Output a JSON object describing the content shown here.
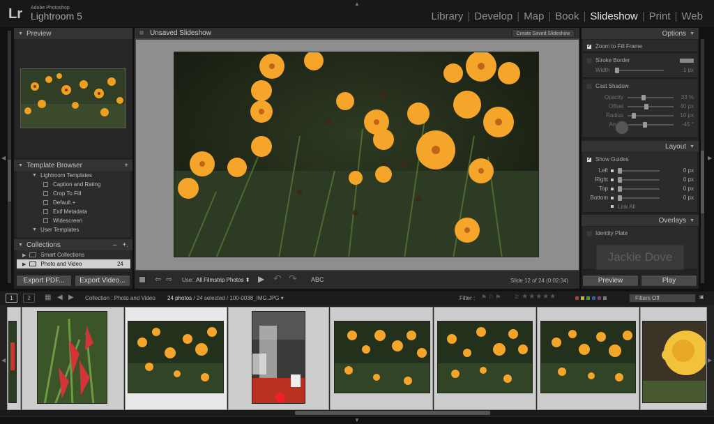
{
  "app": {
    "logo": "Lr",
    "brand_small": "Adobe Photoshop",
    "brand_name": "Lightroom 5"
  },
  "modules": [
    {
      "label": "Library",
      "active": false
    },
    {
      "label": "Develop",
      "active": false
    },
    {
      "label": "Map",
      "active": false
    },
    {
      "label": "Book",
      "active": false
    },
    {
      "label": "Slideshow",
      "active": true
    },
    {
      "label": "Print",
      "active": false
    },
    {
      "label": "Web",
      "active": false
    }
  ],
  "left_panel": {
    "preview_header": "Preview",
    "template_browser_header": "Template Browser",
    "template_browser_add": "+",
    "lightroom_templates": "Lightroom Templates",
    "templates": [
      "Caption and Rating",
      "Crop To Fill",
      "Default +",
      "Exif Metadata",
      "Widescreen"
    ],
    "user_templates": "User Templates",
    "collections_header": "Collections",
    "collections_minus": "–",
    "collections_plus": "+.",
    "smart_collections": "Smart Collections",
    "photo_and_video": "Photo and Video",
    "photo_and_video_count": "24",
    "export_pdf": "Export PDF...",
    "export_video": "Export Video..."
  },
  "center": {
    "title": "Unsaved Slideshow",
    "create_saved": "Create Saved Slideshow",
    "use_label": "Use:",
    "use_value": "All Filmstrip Photos",
    "abc": "ABC",
    "slide_info": "Slide 12 of 24 (0:02:34)"
  },
  "right_panel": {
    "options_header": "Options",
    "zoom_to_fill": "Zoom to Fill Frame",
    "stroke_border": "Stroke Border",
    "width_label": "Width",
    "width_value": "1 px",
    "cast_shadow": "Cast Shadow",
    "shadow": [
      {
        "label": "Opacity",
        "value": "33 %",
        "level": 0.33
      },
      {
        "label": "Offset",
        "value": "40 px",
        "level": 0.4
      },
      {
        "label": "Radius",
        "value": "10 px",
        "level": 0.1
      },
      {
        "label": "Angle",
        "value": "-45 °",
        "level": 0.37
      }
    ],
    "layout_header": "Layout",
    "show_guides": "Show Guides",
    "guides": [
      {
        "label": "Left",
        "value": "0 px"
      },
      {
        "label": "Right",
        "value": "0 px"
      },
      {
        "label": "Top",
        "value": "0 px"
      },
      {
        "label": "Bottom",
        "value": "0 px"
      }
    ],
    "link_all": "Link All",
    "overlays_header": "Overlays",
    "identity_plate": "Identity Plate",
    "identity_text": "Jackie Dove",
    "preview_button": "Preview",
    "play_button": "Play"
  },
  "filmstrip_bar": {
    "page1": "1",
    "page2": "2",
    "source": "Collection : Photo and Video",
    "photo_count": "24 photos",
    "selection": " / 24 selected / 100-0038_IMG.JPG",
    "filter_label": "Filter :",
    "filters_off": "Filters Off"
  },
  "colors": {
    "accent_orange": "#f0a020",
    "active_module": "#e6e6e6",
    "panel_bg": "#2b2b2b"
  }
}
